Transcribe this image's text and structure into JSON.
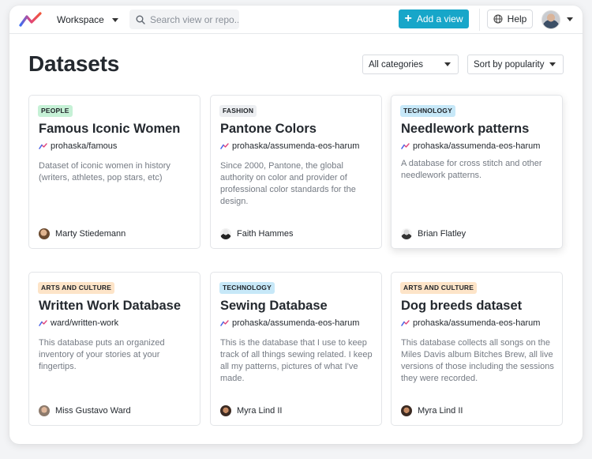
{
  "header": {
    "workspace_label": "Workspace",
    "search_placeholder": "Search view or repo...",
    "add_view_label": "Add a view",
    "help_label": "Help"
  },
  "page": {
    "title": "Datasets",
    "category_select": "All categories",
    "sort_select": "Sort by popularity"
  },
  "colors": {
    "accent": "#17a6c9",
    "badge_people": "#c6f1d6",
    "badge_fashion": "#eceef1",
    "badge_technology": "#c7e8f8",
    "badge_arts": "#fde4c8"
  },
  "cards": [
    {
      "category": "PEOPLE",
      "title": "Famous Iconic Women",
      "repo": "prohaska/famous",
      "description": "Dataset of iconic women in history (writers, athletes, pop stars, etc)",
      "author": "Marty Stiedemann"
    },
    {
      "category": "FASHION",
      "title": "Pantone Colors",
      "repo": "prohaska/assumenda-eos-harum",
      "description": "Since 2000, Pantone, the global authority on color and provider of professional color standards for the design.",
      "author": "Faith Hammes"
    },
    {
      "category": "TECHNOLOGY",
      "title": "Needlework patterns",
      "repo": "prohaska/assumenda-eos-harum",
      "description": "A database for cross stitch and other needlework patterns.",
      "author": "Brian Flatley"
    },
    {
      "category": "ARTS AND CULTURE",
      "title": "Written Work Database",
      "repo": "ward/written-work",
      "description": "This database puts an organized inventory of your stories at your fingertips.",
      "author": "Miss Gustavo Ward"
    },
    {
      "category": "TECHNOLOGY",
      "title": "Sewing Database",
      "repo": "prohaska/assumenda-eos-harum",
      "description": "This is the database that I use to keep track of all things sewing related. I keep all my patterns, pictures of what I've made.",
      "author": "Myra Lind II"
    },
    {
      "category": "ARTS AND CULTURE",
      "title": "Dog breeds dataset",
      "repo": "prohaska/assumenda-eos-harum",
      "description": "This database collects all songs on the Miles Davis album Bitches Brew, all live versions of those including the sessions they were recorded.",
      "author": "Myra Lind II"
    }
  ]
}
